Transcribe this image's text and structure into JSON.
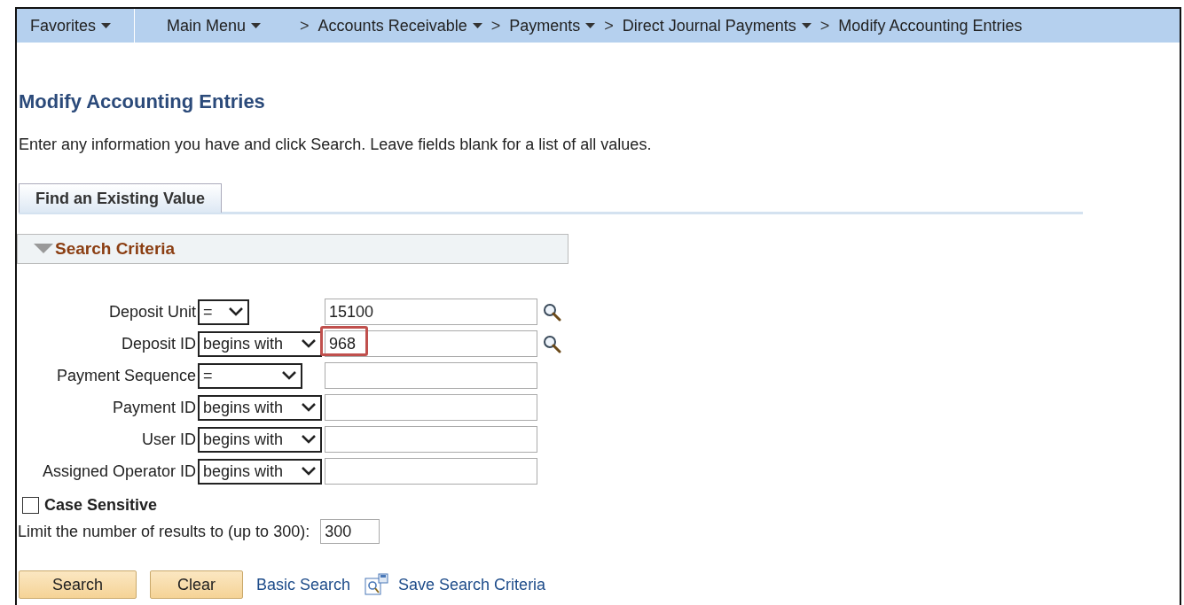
{
  "nav": [
    {
      "label": "Favorites",
      "menu": true
    },
    {
      "label": "Main Menu",
      "menu": true
    },
    {
      "label": "Accounts Receivable",
      "separator": ">",
      "menu": true
    },
    {
      "label": "Payments",
      "separator": ">",
      "menu": true
    },
    {
      "label": "Direct Journal Payments",
      "separator": ">",
      "menu": true
    },
    {
      "label": "Modify Accounting Entries",
      "separator": ">",
      "menu": false
    }
  ],
  "page_title": "Modify Accounting Entries",
  "instructions": "Enter any information you have and click Search. Leave fields blank for a list of all values.",
  "tabs": [
    {
      "label": "Find an Existing Value",
      "selected": true
    }
  ],
  "section": {
    "title": "Search Criteria",
    "expanded": true
  },
  "criteria": [
    {
      "label": "Deposit Unit",
      "operator": "=",
      "value": "15100",
      "lookup": true,
      "highlighted": false,
      "kind": "short"
    },
    {
      "label": "Deposit ID",
      "operator": "begins with",
      "value": "968",
      "lookup": true,
      "highlighted": true,
      "kind": "wide"
    },
    {
      "label": "Payment Sequence",
      "operator": "=",
      "lookup": false,
      "highlighted": false,
      "kind": "medium"
    },
    {
      "label": "Payment ID",
      "operator": "begins with",
      "lookup": false,
      "highlighted": false,
      "kind": "wide"
    },
    {
      "label": "User ID",
      "operator": "begins with",
      "lookup": false,
      "highlighted": false,
      "kind": "wide"
    },
    {
      "label": "Assigned Operator ID",
      "operator": "begins with",
      "lookup": false,
      "highlighted": false,
      "kind": "wide"
    }
  ],
  "case_sensitive": {
    "label": "Case Sensitive",
    "checked": false
  },
  "limit": {
    "label": "Limit the number of results to (up to 300):",
    "value": "300"
  },
  "buttons": [
    "Search",
    "Clear"
  ],
  "links": [
    {
      "label": "Basic Search",
      "kind": "plain"
    },
    {
      "label": "Save Search Criteria",
      "kind": "save"
    }
  ]
}
